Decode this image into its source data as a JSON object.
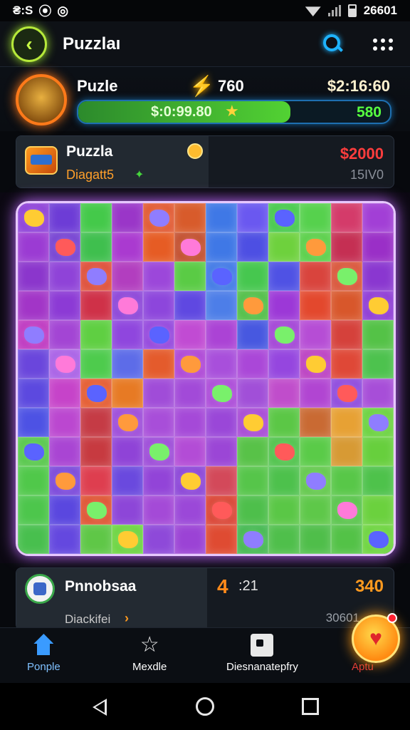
{
  "status_bar": {
    "left_text": "₴:S",
    "time": "26601",
    "icons": [
      "sim-icon",
      "notification-icon",
      "wifi-icon",
      "signal-icon",
      "battery-icon"
    ]
  },
  "app_bar": {
    "title": "Puzzlaı",
    "back_icon": "chevron-left-icon",
    "search_icon": "search-icon",
    "more_icon": "grid-menu-icon"
  },
  "player": {
    "name": "Puzle",
    "energy": "760",
    "timer": "$2:16:60",
    "progress_text": "$:0:99.80",
    "progress_fraction": 0.68,
    "progress_score": "580"
  },
  "level": {
    "name": "Puzzla",
    "subtitle": "Diagatt5",
    "price": "$2000",
    "price_sub": "15IV0"
  },
  "board": {
    "rows": 12,
    "cols": 12,
    "colors": [
      [
        "#8d3fd8",
        "#6d3cd6",
        "#44c94a",
        "#9a36c8",
        "#e1572f",
        "#d85b2b",
        "#3f78e6",
        "#6a58f0",
        "#44c94a",
        "#56d14d",
        "#d43b6a",
        "#a23fd6"
      ],
      [
        "#9b3bd3",
        "#7440d2",
        "#3fbf4e",
        "#aa3ad0",
        "#e65c24",
        "#c24c2b",
        "#3f78e6",
        "#4d4fe3",
        "#6ed13d",
        "#58cf47",
        "#c52f53",
        "#9a2fc7"
      ],
      [
        "#8b36cc",
        "#8f43d8",
        "#de4d37",
        "#b23ebf",
        "#9c47da",
        "#5acb45",
        "#3f78e6",
        "#46c74f",
        "#4f52e4",
        "#d9443d",
        "#d95438",
        "#8a37d0"
      ],
      [
        "#a235c7",
        "#8c3ad5",
        "#cf3148",
        "#8b43d8",
        "#8d46dc",
        "#5f48e1",
        "#4d7ee8",
        "#4fbe45",
        "#9c38d7",
        "#e3482d",
        "#d8572b",
        "#8d39d5"
      ],
      [
        "#be36c0",
        "#a345d4",
        "#5fcf42",
        "#8f46de",
        "#9345dd",
        "#c14bd3",
        "#ab43d5",
        "#4758e0",
        "#a243d6",
        "#b64dd5",
        "#d5413b",
        "#54c247"
      ],
      [
        "#6a46dc",
        "#a85fe6",
        "#4ecb4d",
        "#5d6ce8",
        "#e45b2c",
        "#ad44d6",
        "#a84fdb",
        "#aa47d8",
        "#9546df",
        "#bb3fc2",
        "#df4837",
        "#4dc24e"
      ],
      [
        "#5c49df",
        "#c643c9",
        "#e55a2e",
        "#e77a24",
        "#a04cd8",
        "#a24ad8",
        "#ab49d8",
        "#a14fd8",
        "#c04dcb",
        "#b145d2",
        "#8d48dd",
        "#a74ed8"
      ],
      [
        "#4d52e4",
        "#bb47d0",
        "#c53b45",
        "#9c4ad9",
        "#a84ed9",
        "#a549d8",
        "#9a47d8",
        "#a648d5",
        "#5bc746",
        "#c96a33",
        "#e7a134",
        "#69d23d"
      ],
      [
        "#55c749",
        "#a945d3",
        "#c73a40",
        "#8f43d7",
        "#9c4ad8",
        "#b34cd6",
        "#9b46d6",
        "#58c248",
        "#4ec34a",
        "#5acb48",
        "#d79a34",
        "#67cf3d"
      ],
      [
        "#50c84a",
        "#7946da",
        "#de3e4f",
        "#6a49de",
        "#9244d8",
        "#8a43d7",
        "#d3495a",
        "#56c54a",
        "#4dc14c",
        "#61c84a",
        "#58c748",
        "#4ec24b"
      ],
      [
        "#4dc64c",
        "#5a47df",
        "#de5230",
        "#8d46d8",
        "#a44ad7",
        "#9b48d8",
        "#da4232",
        "#4ebf4b",
        "#5ac746",
        "#5ec849",
        "#57c449",
        "#6bd13e"
      ],
      [
        "#48bf4e",
        "#6448df",
        "#5fc747",
        "#6ad43e",
        "#8e49d9",
        "#9b43d5",
        "#df4b32",
        "#42b84f",
        "#4fbf4b",
        "#4fbe4a",
        "#53c247",
        "#6bd43c"
      ]
    ]
  },
  "info_card": {
    "title": "Pnnobsaa",
    "subtitle": "Diackifei",
    "level_number": "4",
    "time": ":21",
    "score": "340",
    "code": "30601"
  },
  "bottom_nav": [
    {
      "label": "Ponple",
      "icon": "home-icon",
      "active": true
    },
    {
      "label": "Mexdle",
      "icon": "star-icon",
      "active": false
    },
    {
      "label": "Diesnanatepfry",
      "icon": "puzzle-icon",
      "active": false
    },
    {
      "label": "Aptu",
      "icon": "heart-icon",
      "active": false
    }
  ],
  "android_nav": {
    "back": "back-icon",
    "home": "home-circle-icon",
    "recents": "recents-icon"
  }
}
